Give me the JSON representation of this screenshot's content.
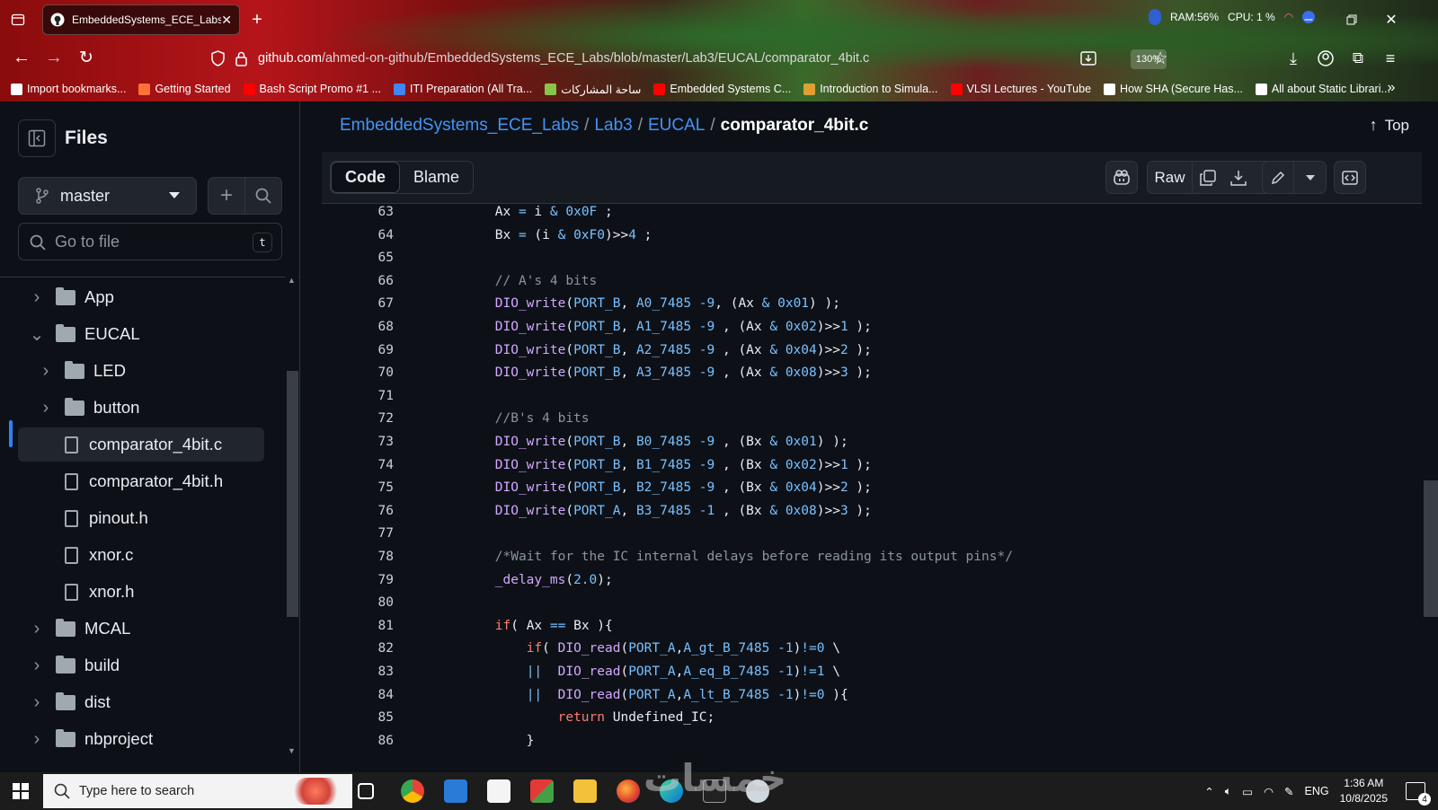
{
  "browser": {
    "tab_title": "EmbeddedSystems_ECE_Labs/L",
    "url_host": "github.com",
    "url_path": "/ahmed-on-github/EmbeddedSystems_ECE_Labs/blob/master/Lab3/EUCAL/comparator_4bit.c",
    "zoom": "130%",
    "sysmon": {
      "ram": "RAM:56%",
      "cpu": "CPU: 1 %"
    },
    "bookmarks": [
      {
        "label": "Import bookmarks...",
        "color": "#ffffff"
      },
      {
        "label": "Getting Started",
        "color": "#ff7139"
      },
      {
        "label": "Bash Script Promo #1 ...",
        "color": "#ff0000"
      },
      {
        "label": "ITI Preparation (All Tra...",
        "color": "#4285f4"
      },
      {
        "label": "ساحة المشاركات",
        "color": "#8bc34a"
      },
      {
        "label": "Embedded Systems C...",
        "color": "#ff0000"
      },
      {
        "label": "Introduction to Simula...",
        "color": "#e0a030"
      },
      {
        "label": "VLSI Lectures - YouTube",
        "color": "#ff0000"
      },
      {
        "label": "How SHA (Secure Has...",
        "color": "#ffffff"
      },
      {
        "label": "All about Static Librari...",
        "color": "#ffffff"
      }
    ]
  },
  "sidebar": {
    "title": "Files",
    "branch": "master",
    "goto_placeholder": "Go to file",
    "goto_shortcut": "t",
    "tree": [
      {
        "label": "App",
        "type": "folder",
        "depth": 0,
        "expanded": false
      },
      {
        "label": "EUCAL",
        "type": "folder",
        "depth": 0,
        "expanded": true
      },
      {
        "label": "LED",
        "type": "folder",
        "depth": 1,
        "expanded": false
      },
      {
        "label": "button",
        "type": "folder",
        "depth": 1,
        "expanded": false
      },
      {
        "label": "comparator_4bit.c",
        "type": "file",
        "depth": 1,
        "selected": true
      },
      {
        "label": "comparator_4bit.h",
        "type": "file",
        "depth": 1
      },
      {
        "label": "pinout.h",
        "type": "file",
        "depth": 1
      },
      {
        "label": "xnor.c",
        "type": "file",
        "depth": 1
      },
      {
        "label": "xnor.h",
        "type": "file",
        "depth": 1
      },
      {
        "label": "MCAL",
        "type": "folder",
        "depth": 0,
        "expanded": false
      },
      {
        "label": "build",
        "type": "folder",
        "depth": 0,
        "expanded": false
      },
      {
        "label": "dist",
        "type": "folder",
        "depth": 0,
        "expanded": false
      },
      {
        "label": "nbproject",
        "type": "folder",
        "depth": 0,
        "expanded": false
      }
    ]
  },
  "breadcrumb": {
    "repo": "EmbeddedSystems_ECE_Labs",
    "dir1": "Lab3",
    "dir2": "EUCAL",
    "file": "comparator_4bit.c",
    "sep": "/",
    "top": "Top"
  },
  "file_header": {
    "code_tab": "Code",
    "blame_tab": "Blame",
    "raw": "Raw"
  },
  "code": [
    {
      "n": "63",
      "t": "            Ax = i & 0x0F ;"
    },
    {
      "n": "64",
      "t": "            Bx = (i & 0xF0)>>4 ;"
    },
    {
      "n": "65",
      "t": ""
    },
    {
      "n": "66",
      "t": "            // A's 4 bits"
    },
    {
      "n": "67",
      "t": "            DIO_write(PORT_B, A0_7485 -9, (Ax & 0x01) );"
    },
    {
      "n": "68",
      "t": "            DIO_write(PORT_B, A1_7485 -9 , (Ax & 0x02)>>1 );"
    },
    {
      "n": "69",
      "t": "            DIO_write(PORT_B, A2_7485 -9 , (Ax & 0x04)>>2 );"
    },
    {
      "n": "70",
      "t": "            DIO_write(PORT_B, A3_7485 -9 , (Ax & 0x08)>>3 );"
    },
    {
      "n": "71",
      "t": ""
    },
    {
      "n": "72",
      "t": "            //B's 4 bits"
    },
    {
      "n": "73",
      "t": "            DIO_write(PORT_B, B0_7485 -9 , (Bx & 0x01) );"
    },
    {
      "n": "74",
      "t": "            DIO_write(PORT_B, B1_7485 -9 , (Bx & 0x02)>>1 );"
    },
    {
      "n": "75",
      "t": "            DIO_write(PORT_B, B2_7485 -9 , (Bx & 0x04)>>2 );"
    },
    {
      "n": "76",
      "t": "            DIO_write(PORT_A, B3_7485 -1 , (Bx & 0x08)>>3 );"
    },
    {
      "n": "77",
      "t": ""
    },
    {
      "n": "78",
      "t": "            /*Wait for the IC internal delays before reading its output pins*/"
    },
    {
      "n": "79",
      "t": "            _delay_ms(2.0);"
    },
    {
      "n": "80",
      "t": ""
    },
    {
      "n": "81",
      "t": "            if( Ax == Bx ){"
    },
    {
      "n": "82",
      "t": "                if( DIO_read(PORT_A,A_gt_B_7485 -1)!=0 \\"
    },
    {
      "n": "83",
      "t": "                ||  DIO_read(PORT_A,A_eq_B_7485 -1)!=1 \\"
    },
    {
      "n": "84",
      "t": "                ||  DIO_read(PORT_A,A_lt_B_7485 -1)!=0 ){"
    },
    {
      "n": "85",
      "t": "                    return Undefined_IC;"
    },
    {
      "n": "86",
      "t": "                }"
    }
  ],
  "taskbar": {
    "search_placeholder": "Type here to search",
    "lang": "ENG",
    "time": "1:36 AM",
    "date": "10/8/2025",
    "notif_count": "4"
  },
  "watermark": "خمسات"
}
